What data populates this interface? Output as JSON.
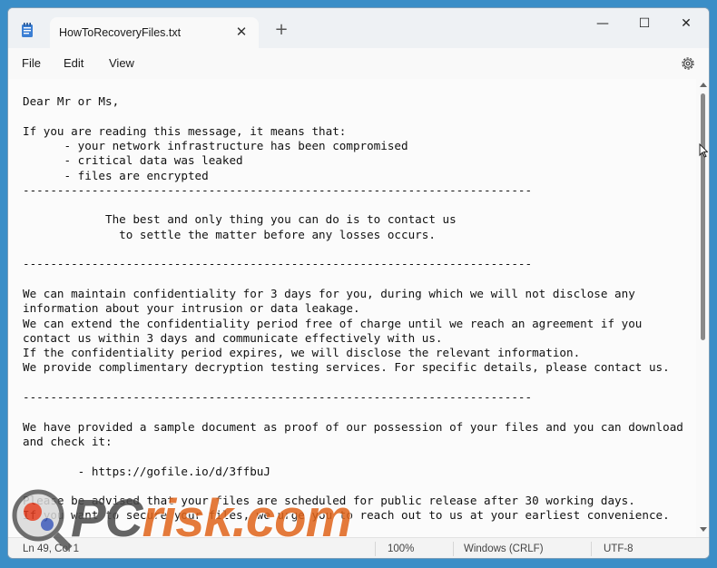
{
  "app": {
    "icon": "notepad-icon"
  },
  "tab": {
    "title": "HowToRecoveryFiles.txt",
    "close_icon": "close-icon",
    "new_tab_icon": "plus-icon"
  },
  "window_controls": {
    "minimize": "minimize-icon",
    "maximize": "maximize-icon",
    "close": "close-icon"
  },
  "menu": {
    "file": "File",
    "edit": "Edit",
    "view": "View",
    "settings_icon": "gear-icon"
  },
  "editor": {
    "lines": [
      "Dear Mr or Ms,",
      "",
      "If you are reading this message, it means that:",
      "      - your network infrastructure has been compromised",
      "      - critical data was leaked",
      "      - files are encrypted",
      "--------------------------------------------------------------------------",
      "",
      "            The best and only thing you can do is to contact us",
      "              to settle the matter before any losses occurs.",
      "",
      "--------------------------------------------------------------------------",
      "",
      "We can maintain confidentiality for 3 days for you, during which we will not disclose any",
      "information about your intrusion or data leakage.",
      "We can extend the confidentiality period free of charge until we reach an agreement if you",
      "contact us within 3 days and communicate effectively with us.",
      "If the confidentiality period expires, we will disclose the relevant information.",
      "We provide complimentary decryption testing services. For specific details, please contact us.",
      "",
      "--------------------------------------------------------------------------",
      "",
      "We have provided a sample document as proof of our possession of your files and you can download",
      "and check it:",
      "",
      "        - https://gofile.io/d/3ffbuJ",
      "",
      "Please be advised that your files are scheduled for public release after 30 working days.",
      "If you want to secure your files, we urge you to reach out to us at your earliest convenience."
    ]
  },
  "status": {
    "position": "Ln 49, Col 1",
    "zoom": "100%",
    "line_ending": "Windows (CRLF)",
    "encoding": "UTF-8"
  },
  "watermark": {
    "brand_a": "PC",
    "brand_b": "risk.com"
  }
}
